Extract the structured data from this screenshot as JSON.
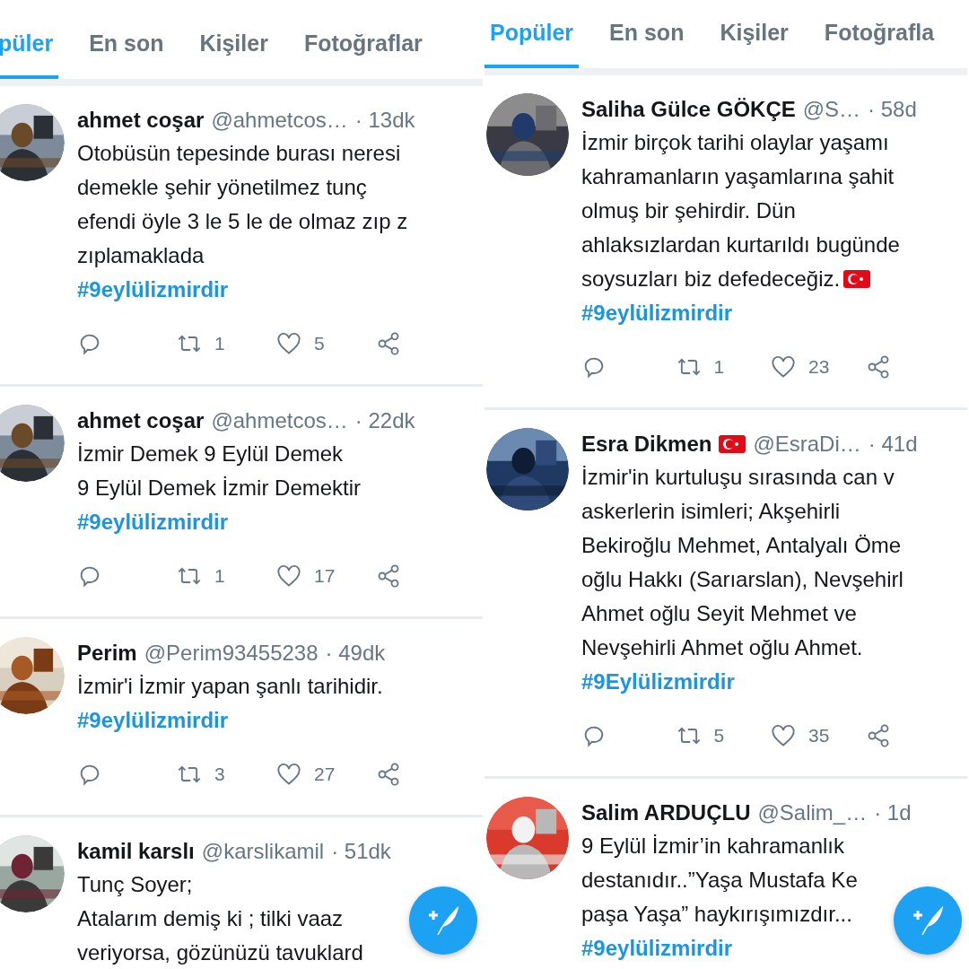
{
  "panels": [
    {
      "tabs": [
        {
          "label": "püler",
          "selected": true
        },
        {
          "label": "En son",
          "selected": false
        },
        {
          "label": "Kişiler",
          "selected": false
        },
        {
          "label": "Fotoğraflar",
          "selected": false
        }
      ],
      "tweets": [
        {
          "name": "ahmet coşar",
          "name_flag": false,
          "handle": "@ahmetcos…",
          "time": "· 13dk",
          "body": [
            "Otobüsün tepesinde burası neresi",
            "demekle şehir yönetilmez tunç",
            "efendi öyle 3 le 5 le de olmaz zıp z",
            "zıplamaklada"
          ],
          "body_flag": false,
          "hashtag": "#9eylülizmirdir",
          "actions": {
            "retweets": "1",
            "likes": "5"
          }
        },
        {
          "name": "ahmet coşar",
          "name_flag": false,
          "handle": "@ahmetcos…",
          "time": "· 22dk",
          "body": [
            "İzmir Demek 9 Eylül Demek",
            "9 Eylül Demek İzmir Demektir"
          ],
          "body_flag": false,
          "hashtag": "#9eylülizmirdir",
          "actions": {
            "retweets": "1",
            "likes": "17"
          }
        },
        {
          "name": "Perim",
          "name_flag": false,
          "handle": "@Perim93455238",
          "time": "· 49dk",
          "body": [
            "İzmir'i İzmir yapan şanlı tarihidir."
          ],
          "body_flag": false,
          "hashtag": "#9eylülizmirdir",
          "actions": {
            "retweets": "3",
            "likes": "27"
          }
        },
        {
          "name": "kamil karslı",
          "name_flag": false,
          "handle": "@karslikamil",
          "time": "· 51dk",
          "body": [
            "Tunç Soyer;",
            "Atalarım demiş ki ; tilki vaaz",
            "veriyorsa, gözünüzü tavuklard"
          ],
          "body_flag": false
        }
      ]
    },
    {
      "tabs": [
        {
          "label": "Popüler",
          "selected": true
        },
        {
          "label": "En son",
          "selected": false
        },
        {
          "label": "Kişiler",
          "selected": false
        },
        {
          "label": "Fotoğrafla",
          "selected": false
        }
      ],
      "tweets": [
        {
          "name": "Saliha Gülce GÖKÇE",
          "name_flag": false,
          "handle": "@S…",
          "time": "· 58d",
          "body": [
            "İzmir birçok tarihi olaylar yaşamı",
            "kahramanların yaşamlarına şahit",
            "olmuş bir şehirdir. Dün",
            "ahlaksızlardan kurtarıldı bugünde",
            "soysuzları biz defedeceğiz."
          ],
          "body_flag": true,
          "hashtag": "#9eylülizmirdir",
          "actions": {
            "retweets": "1",
            "likes": "23"
          }
        },
        {
          "name": "Esra Dikmen",
          "name_flag": true,
          "handle": "@EsraDi…",
          "time": "· 41d",
          "body": [
            "İzmir'in kurtuluşu sırasında can v",
            "askerlerin isimleri; Akşehirli",
            "Bekiroğlu Mehmet, Antalyalı Öme",
            "oğlu Hakkı (Sarıarslan), Nevşehirl",
            "Ahmet oğlu Seyit Mehmet ve",
            "Nevşehirli Ahmet oğlu Ahmet."
          ],
          "body_flag": false,
          "hashtag": "#9Eylülizmirdir",
          "actions": {
            "retweets": "5",
            "likes": "35"
          }
        },
        {
          "name": "Salim ARDUÇLU",
          "name_flag": false,
          "handle": "@Salim_…",
          "time": "· 1d",
          "body": [
            "9 Eylül İzmir’in kahramanlık",
            "destanıdır..”Yaşa Mustafa Ke",
            "paşa Yaşa” haykırışımızdır..."
          ],
          "body_flag": false,
          "hashtag": "#9eylülizmirdir"
        }
      ]
    }
  ]
}
